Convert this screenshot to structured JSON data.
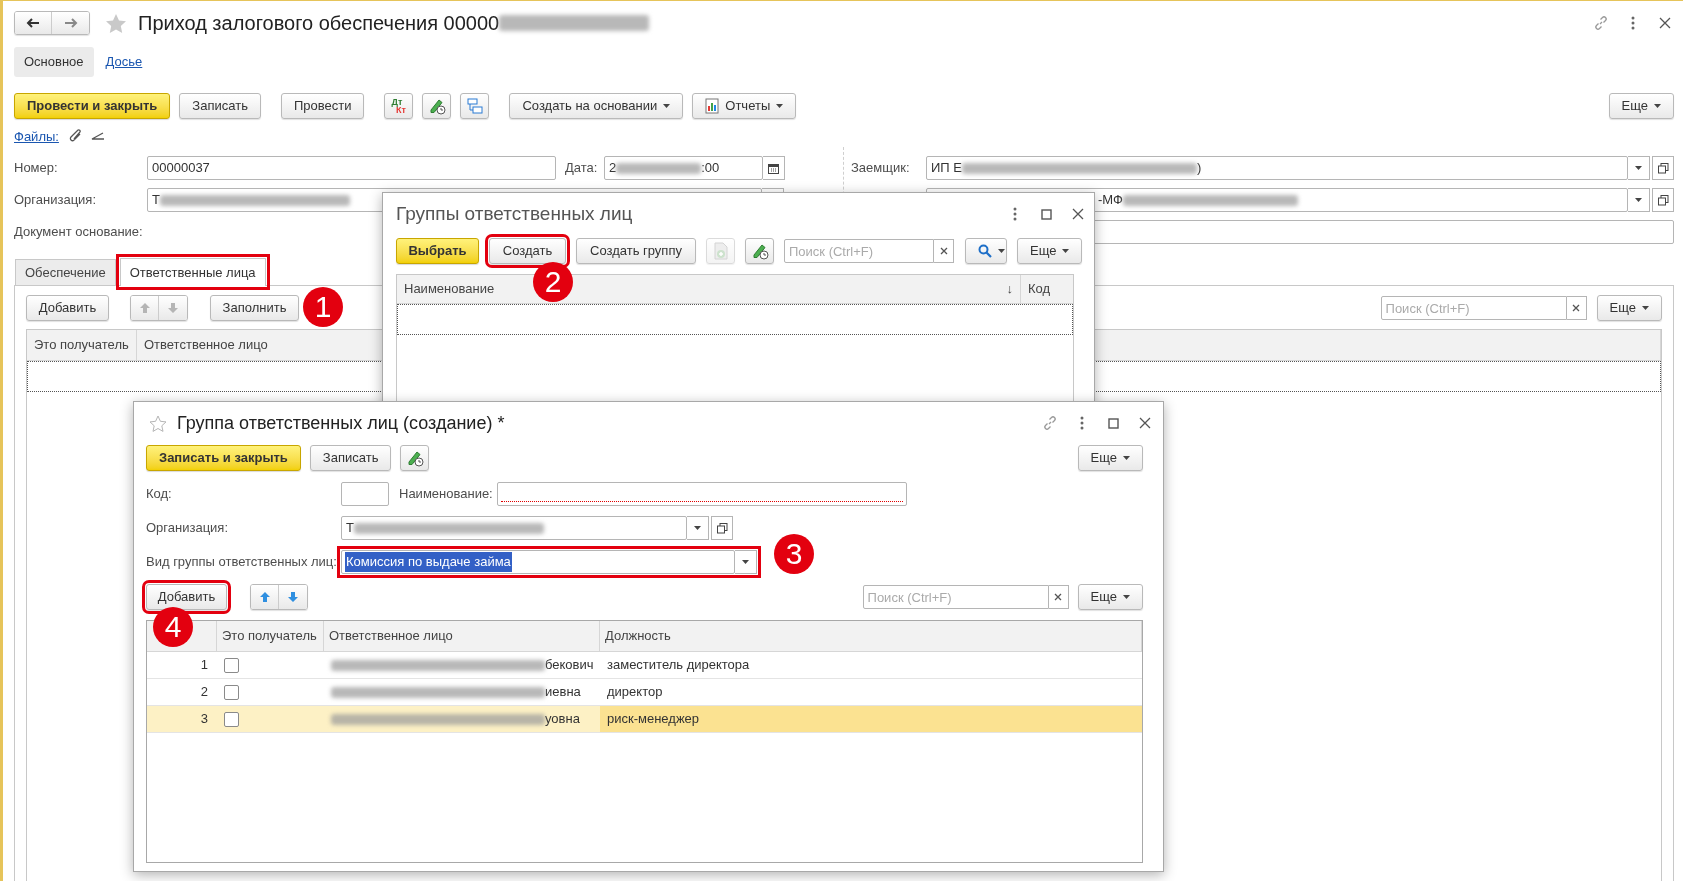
{
  "window": {
    "title": "Приход залогового обеспечения 00000",
    "title_redacted": true
  },
  "sections": [
    {
      "label": "Основное",
      "selected": true
    },
    {
      "label": "Досье",
      "selected": false
    }
  ],
  "toolbar": {
    "groups": [
      [
        {
          "kind": "primary",
          "label": "Провести и закрыть"
        },
        {
          "kind": "text",
          "label": "Записать"
        }
      ],
      [
        {
          "kind": "text",
          "label": "Провести"
        }
      ],
      [
        {
          "kind": "dtkt",
          "top": "Дт",
          "bottom": "Кт"
        },
        {
          "kind": "history"
        },
        {
          "kind": "structure"
        }
      ],
      [
        {
          "kind": "menu",
          "label": "Создать на основании"
        },
        {
          "kind": "report",
          "label": "Отчеты"
        }
      ]
    ],
    "more": "Еще"
  },
  "files": {
    "label": "Файлы:"
  },
  "fields": {
    "number": {
      "label": "Номер:",
      "value": "00000037"
    },
    "date": {
      "label": "Дата:",
      "value_start": "2",
      "value_end": ":00",
      "redacted": true
    },
    "organization": {
      "label": "Организация:",
      "value_start": "Т",
      "redacted": true
    },
    "basis": {
      "label": "Документ основание:"
    },
    "borrower": {
      "label": "Заемщик:",
      "value_start": "ИП Е",
      "value_end": ")",
      "redacted": true
    },
    "field_6": {
      "value_start": "-МФ",
      "redacted": true
    }
  },
  "tabs": [
    {
      "label": "Обеспечение",
      "selected": false,
      "highlighted": false
    },
    {
      "label": "Ответственные лица",
      "selected": true,
      "highlighted": true
    }
  ],
  "tab_toolbar": {
    "add": "Добавить",
    "fill": "Заполнить",
    "fill_marker": "1",
    "search_placeholder": "Поиск (Ctrl+F)",
    "more": "Еще"
  },
  "table": {
    "columns": [
      "Это получатель",
      "Ответственное лицо"
    ]
  },
  "groups_dialog": {
    "title": "Группы ответственных лиц",
    "buttons": [
      {
        "kind": "primary",
        "label": "Выбрать",
        "highlighted": false,
        "disabled": false
      },
      {
        "kind": "text",
        "label": "Создать",
        "highlighted": true,
        "marker": "2",
        "disabled": false
      },
      {
        "kind": "text",
        "label": "Создать группу",
        "highlighted": false,
        "disabled": false
      },
      {
        "kind": "copy",
        "highlighted": false,
        "disabled": true
      },
      {
        "kind": "history",
        "highlighted": false,
        "disabled": false
      }
    ],
    "search_placeholder": "Поиск (Ctrl+F)",
    "more": "Еще",
    "columns": [
      "Наименование",
      "Код"
    ],
    "sort_mark": "↓"
  },
  "group_dialog": {
    "title": "Группа ответственных лиц (создание) *",
    "buttons": [
      {
        "kind": "primary",
        "label": "Записать и закрыть"
      },
      {
        "kind": "text",
        "label": "Записать"
      },
      {
        "kind": "history"
      }
    ],
    "more": "Еще",
    "code": {
      "label": "Код:"
    },
    "name": {
      "label": "Наименование:",
      "invalid": true
    },
    "organization": {
      "label": "Организация:",
      "value_start": "Т",
      "redacted": true
    },
    "group_kind": {
      "label": "Вид группы ответственных лиц:",
      "value": "Комиссия по выдаче займа",
      "text_selected": true,
      "highlighted": true,
      "marker": "3"
    },
    "add": {
      "label": "Добавить",
      "highlighted": true,
      "marker": "4"
    },
    "search_placeholder": "Поиск (Ctrl+F)",
    "more_table": "Еще",
    "columns": [
      "Это получатель",
      "Ответственное лицо",
      "Должность"
    ],
    "rows": [
      {
        "number": "1",
        "recipient": false,
        "person_end": "бекович",
        "position": "заместитель директора",
        "selected": false
      },
      {
        "number": "2",
        "recipient": false,
        "person_end": "иевна",
        "position": "директор",
        "selected": false
      },
      {
        "number": "3",
        "recipient": false,
        "person_end": "уовна",
        "position": "риск-менеджер",
        "selected": true
      }
    ]
  }
}
